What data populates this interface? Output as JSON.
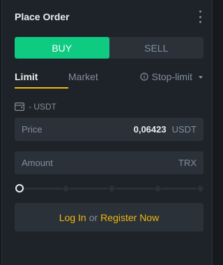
{
  "header": {
    "title": "Place Order"
  },
  "sides": {
    "buy": "BUY",
    "sell": "SELL"
  },
  "tabs": {
    "limit": "Limit",
    "market": "Market",
    "stop_limit": "Stop-limit"
  },
  "balance": {
    "text": "- USDT",
    "icon": "wallet-icon"
  },
  "price": {
    "label": "Price",
    "value": "0,06423",
    "unit": "USDT"
  },
  "amount": {
    "label": "Amount",
    "unit": "TRX"
  },
  "slider": {
    "value_percent": 0,
    "steps": [
      0,
      25,
      50,
      75,
      100
    ]
  },
  "auth": {
    "login": "Log In",
    "or": "or",
    "register": "Register Now"
  },
  "colors": {
    "buy": "#0ecb81",
    "accent": "#f0b90b",
    "panel": "#1e2329",
    "input": "#2b3139",
    "muted": "#848e9c",
    "text": "#eaecef"
  }
}
